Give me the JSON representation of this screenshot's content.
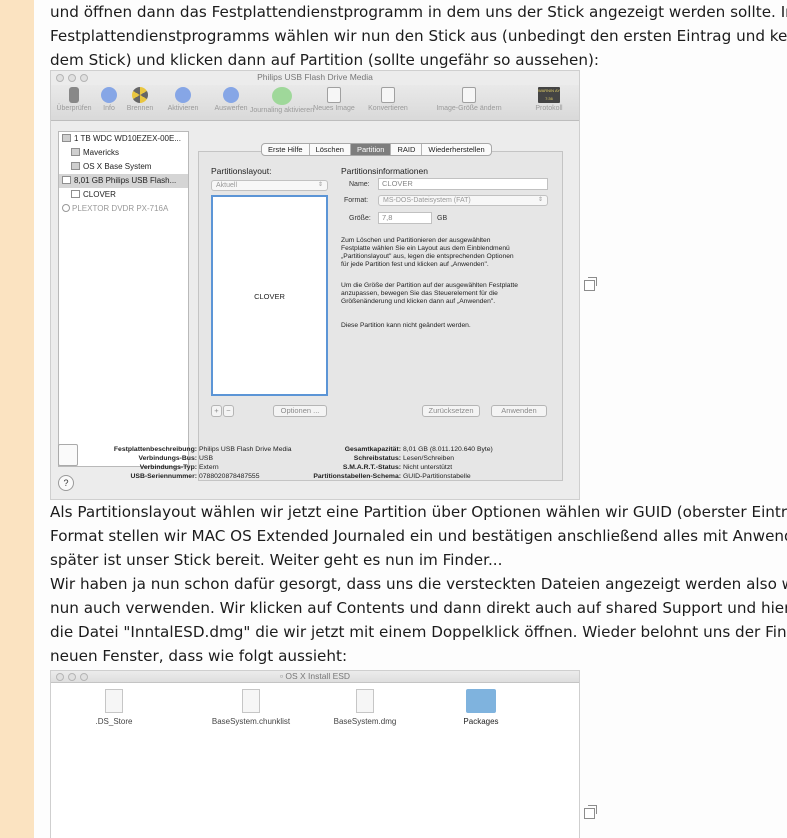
{
  "article": {
    "para1": [
      "und öffnen dann das Festplattendienstprogramm in dem uns der Stick angezeigt werden sollte. In der A",
      "Festplattendienstprogramms wählen wir nun den Stick aus (unbedingt den ersten Eintrag und keine Par",
      "dem Stick) und klicken dann auf Partition (sollte ungefähr so aussehen):"
    ],
    "para2": [
      "Als Partitionslayout wählen wir jetzt eine Partition über Optionen wählen wir GUID (oberster Eintrag) u",
      "Format stellen wir MAC OS Extended Journaled ein und bestätigen anschließend alles mit Anwenden un",
      "später ist unser Stick bereit. Weiter geht es nun im Finder...",
      "Wir haben ja nun schon dafür gesorgt, dass uns die versteckten Dateien angezeigt werden also werden",
      "nun auch verwenden. Wir klicken auf Contents und dann direkt auch auf shared Support und hier offen",
      "die Datei \"InntalESD.dmg\" die wir jetzt mit einem Doppelklick öffnen. Wieder belohnt uns der Finder m",
      "neuen Fenster, dass wie folgt aussieht:"
    ]
  },
  "disk_utility": {
    "title": "Philips USB Flash Drive Media",
    "toolbar": [
      {
        "label": "Überprüfen",
        "icon": "microscope-icon"
      },
      {
        "label": "Info",
        "icon": "info-icon"
      },
      {
        "label": "Brennen",
        "icon": "burn-icon"
      },
      {
        "label": "Aktivieren",
        "icon": "mount-icon"
      },
      {
        "label": "Auswerfen",
        "icon": "eject-icon"
      },
      {
        "label": "Journaling aktivieren",
        "icon": "journaling-icon"
      },
      {
        "label": "Neues Image",
        "icon": "new-image-icon"
      },
      {
        "label": "Konvertieren",
        "icon": "convert-icon"
      },
      {
        "label": "Image-Größe ändern",
        "icon": "resize-image-icon"
      },
      {
        "label": "Protokoll",
        "icon": "log-icon",
        "badge": "WARNIN\nAY 7:36"
      }
    ],
    "sidebar": [
      {
        "label": "1 TB WDC WD10EZEX-00E...",
        "icon": "disk-icon"
      },
      {
        "label": "Mavericks",
        "icon": "volume-icon"
      },
      {
        "label": "OS X Base System",
        "icon": "volume-icon"
      },
      {
        "label": "8,01 GB Philips USB Flash...",
        "icon": "usb-disk-icon"
      },
      {
        "label": "CLOVER",
        "icon": "volume-icon"
      },
      {
        "label": "PLEXTOR DVDR PX-716A",
        "icon": "optical-drive-icon"
      }
    ],
    "tabs": [
      "Erste Hilfe",
      "Löschen",
      "Partition",
      "RAID",
      "Wiederherstellen"
    ],
    "active_tab": "Partition",
    "partition_layout_label": "Partitionslayout:",
    "partition_layout_value": "Aktuell",
    "partition_label": "CLOVER",
    "info_heading": "Partitionsinformationen",
    "name_label": "Name:",
    "name_value": "CLOVER",
    "format_label": "Format:",
    "format_value": "MS-DOS-Dateisystem (FAT)",
    "size_label": "Größe:",
    "size_value": "7,8",
    "size_unit": "GB",
    "info_text_1": [
      "Zum Löschen und Partitionieren der ausgewählten",
      "Festplatte wählen Sie ein Layout aus dem Einblendmenü",
      "„Partitionslayout\" aus, legen die entsprechenden Optionen",
      "für jede Partition fest und klicken auf „Anwenden\"."
    ],
    "info_text_2": [
      "Um die Größe der Partition auf der ausgewählten Festplatte",
      "anzupassen, bewegen Sie das Steuerelement für die",
      "Größenänderung und klicken dann auf „Anwenden\"."
    ],
    "info_text_3": "Diese Partition kann nicht geändert werden.",
    "add_button": "+",
    "remove_button": "−",
    "options_button": "Optionen ...",
    "revert_button": "Zurücksetzen",
    "apply_button": "Anwenden",
    "details_left": [
      {
        "key": "Festplattenbeschreibung:",
        "value": "Philips USB Flash Drive Media"
      },
      {
        "key": "Verbindungs-Bus:",
        "value": "USB"
      },
      {
        "key": "Verbindungs-Typ:",
        "value": "Extern"
      },
      {
        "key": "USB-Seriennummer:",
        "value": "0788020878487555"
      }
    ],
    "details_right": [
      {
        "key": "Gesamtkapazität:",
        "value": "8,01 GB (8.011.120.640 Byte)"
      },
      {
        "key": "Schreibstatus:",
        "value": "Lesen/Schreiben"
      },
      {
        "key": "S.M.A.R.T.-Status:",
        "value": "Nicht unterstützt"
      },
      {
        "key": "Partitionstabellen-Schema:",
        "value": "GUID-Partitionstabelle"
      }
    ],
    "help_label": "?"
  },
  "finder": {
    "title": "OS X Install ESD",
    "files": [
      {
        "name": ".DS_Store",
        "icon": "file-icon"
      },
      {
        "name": "BaseSystem.chunklist",
        "icon": "file-icon"
      },
      {
        "name": "BaseSystem.dmg",
        "icon": "disk-image-icon"
      },
      {
        "name": "Packages",
        "icon": "folder-icon"
      }
    ]
  }
}
